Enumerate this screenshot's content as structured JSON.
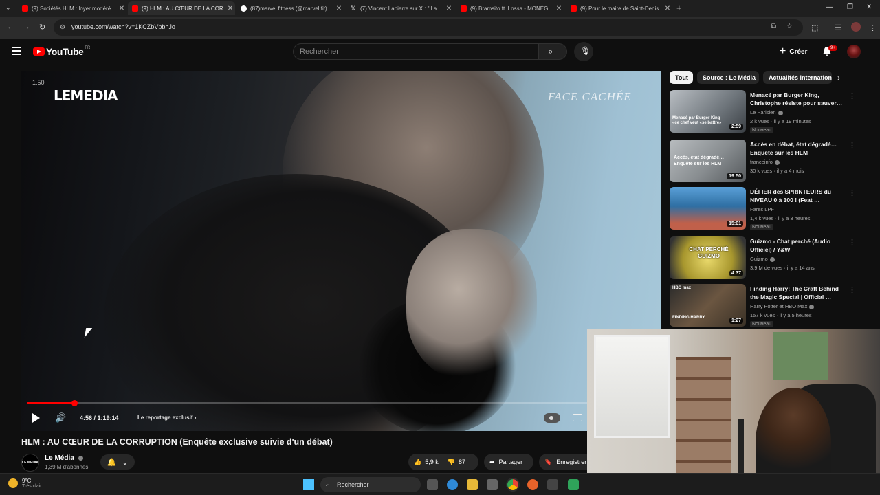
{
  "browser": {
    "tabs": [
      {
        "title": "(9) Sociétés HLM : loyer modéré",
        "icon_color": "#ff0000",
        "active": false
      },
      {
        "title": "(9) HLM : AU CŒUR DE LA COR",
        "icon_color": "#ff0000",
        "active": true
      },
      {
        "title": "(87)marvel fitness (@marvel.fit)",
        "icon_color": "#ffffff",
        "active": false
      },
      {
        "title": "(7) Vincent Lapierre sur X : \"Il a",
        "icon_color": "#ffffff",
        "active": false
      },
      {
        "title": "(9) Bramsito ft. Lossa - MONÉG",
        "icon_color": "#ff0000",
        "active": false
      },
      {
        "title": "(9) Pour le maire de Saint-Denis",
        "icon_color": "#ff0000",
        "active": false
      }
    ],
    "new_tab_icon": "plus-icon",
    "url": "youtube.com/watch?v=1KCZbVpbhJo"
  },
  "youtube": {
    "logo_text": "YouTube",
    "country_code": "FR",
    "search_placeholder": "Rechercher",
    "create_label": "Créer",
    "notification_badge": "9+"
  },
  "player": {
    "speed_label": "1.50",
    "channel_watermark": "LEMEDIA",
    "video_watermark": "FACE CACHÉE",
    "progress_fraction": 0.074,
    "time": "4:56 / 1:19:14",
    "chapter": "Le reportage exclusif",
    "chapter_icon": "chevron-right-icon"
  },
  "video": {
    "title": "HLM : AU CŒUR DE LA CORRUPTION (Enquête exclusive suivie d'un débat)",
    "channel_name": "Le Média",
    "subscribers": "1,39 M d'abonnés",
    "channel_avatar_text": "LE MEDIA",
    "likes": "5,9 k",
    "dislikes": "87",
    "share_label": "Partager",
    "save_label": "Enregistrer"
  },
  "sidebar": {
    "chips": [
      "Tout",
      "Source : Le Média",
      "Actualités internationales"
    ],
    "recommendations": [
      {
        "title": "Menacé par Burger King, Christophe résiste pour sauver…",
        "channel": "Le Parisien",
        "meta": "2 k vues · il y a 19 minutes",
        "duration": "2:59",
        "badge": "Nouveau",
        "thumb_overlay": "Menacé par Burger King «ce chef veut «se battre»",
        "thumb_color": "#8a8f95"
      },
      {
        "title": "Accès en débat, état dégradé… Enquête sur les HLM",
        "channel": "franceinfo",
        "meta": "30 k vues · il y a 4 mois",
        "duration": "19:50",
        "badge": "",
        "thumb_overlay": "Accès, état dégradé… Enquête sur les HLM",
        "thumb_color": "#9aa0a4"
      },
      {
        "title": "DÉFIER des SPRINTEURS du NIVEAU 0 à 100 ! (Feat …",
        "channel": "Fares LPF",
        "meta": "1,4 k vues · il y a 3 heures",
        "duration": "15:01",
        "badge": "Nouveau",
        "thumb_overlay": "",
        "thumb_color": "#3a7fb8"
      },
      {
        "title": "Guizmo - Chat perché (Audio Officiel) / Y&W",
        "channel": "Guizmo",
        "meta": "3,9 M de vues · il y a 14 ans",
        "duration": "4:37",
        "badge": "",
        "thumb_overlay": "CHAT PERCHÉ GUIZMO",
        "thumb_color": "#d8c44a"
      },
      {
        "title": "Finding Harry: The Craft Behind the Magic Special | Official …",
        "channel": "Harry Potter et HBO Max",
        "meta": "157 k vues · il y a 5 heures",
        "duration": "1:27",
        "badge": "Nouveau",
        "thumb_overlay": "FINDING HARRY",
        "thumb_color": "#5a4a3a"
      }
    ]
  },
  "taskbar": {
    "temperature": "9°C",
    "weather": "Très clair",
    "search_label": "Rechercher"
  }
}
